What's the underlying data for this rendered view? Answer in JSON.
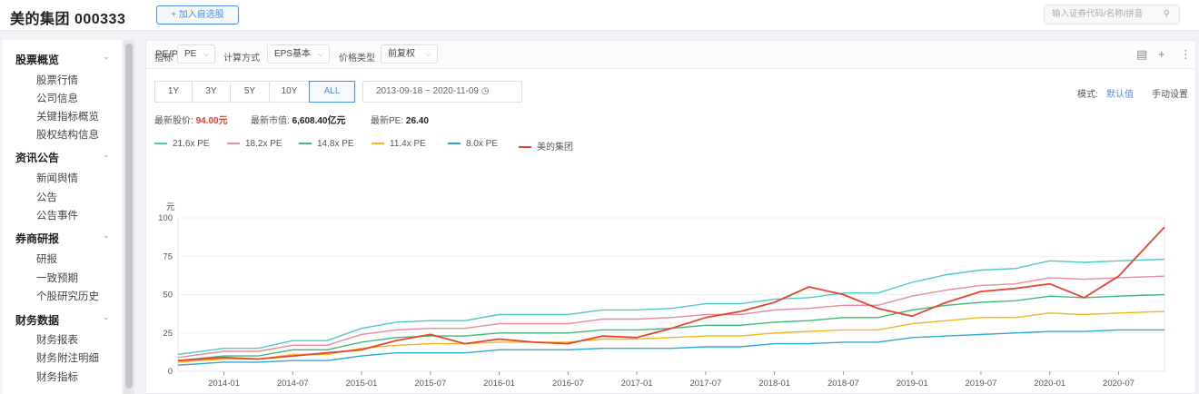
{
  "header": {
    "company": "美的集团  000333",
    "add_button": "+ 加入自选股",
    "search_placeholder": "输入证券代码/名称/拼音",
    "search_icon": "search-icon"
  },
  "sidebar": {
    "sections": [
      {
        "title": "股票概览",
        "items": [
          "股票行情",
          "公司信息",
          "关键指标概览",
          "股权结构信息"
        ]
      },
      {
        "title": "资讯公告",
        "items": [
          "新闻舆情",
          "公告",
          "公告事件"
        ]
      },
      {
        "title": "券商研报",
        "items": [
          "研报",
          "一致预期",
          "个股研究历史"
        ]
      },
      {
        "title": "财务数据",
        "items": [
          "财务报表",
          "财务附注明细",
          "财务指标"
        ]
      }
    ]
  },
  "panel": {
    "title": "PE/PB Bands",
    "controls": {
      "indicator_label": "指标",
      "indicator_value": "PE",
      "calc_label": "计算方式",
      "calc_value": "EPS基本",
      "adjust_label": "价格类型",
      "adjust_value": "前复权"
    },
    "periods": [
      "1Y",
      "3Y",
      "5Y",
      "10Y",
      "ALL"
    ],
    "active_period": "ALL",
    "date_range": "2013-09-18  ~  2020-11-09",
    "mode_label": "模式:",
    "mode_default": "默认值",
    "mode_custom": "手动设置",
    "stats": {
      "price_label": "最新股价:",
      "price_value": "94.00元",
      "mktcap_label": "最新市值:",
      "mktcap_value": "6,608.40亿元",
      "pe_label": "最新PE:",
      "pe_value": "26.40"
    }
  },
  "colors": {
    "band1": "#4fc8c8",
    "band2": "#e88aa0",
    "band3": "#3fb97a",
    "band4": "#f0b722",
    "band5": "#2ea7d8",
    "price": "#e5452f",
    "accent": "#4a90e2"
  },
  "chart_data": {
    "type": "line",
    "y_unit": "元",
    "ylim": [
      0,
      100
    ],
    "y_ticks": [
      "0",
      "25",
      "50",
      "75",
      "100"
    ],
    "x_ticks": [
      "2014-01",
      "2014-07",
      "2015-01",
      "2015-07",
      "2016-01",
      "2016-07",
      "2017-01",
      "2017-07",
      "2018-01",
      "2018-07",
      "2019-01",
      "2019-07",
      "2020-01",
      "2020-07"
    ],
    "x": [
      "2013-09",
      "2014-01",
      "2014-04",
      "2014-07",
      "2014-10",
      "2015-01",
      "2015-04",
      "2015-07",
      "2015-10",
      "2016-01",
      "2016-04",
      "2016-07",
      "2016-10",
      "2017-01",
      "2017-04",
      "2017-07",
      "2017-10",
      "2018-01",
      "2018-04",
      "2018-07",
      "2018-10",
      "2019-01",
      "2019-04",
      "2019-07",
      "2019-10",
      "2020-01",
      "2020-04",
      "2020-07",
      "2020-11"
    ],
    "series": [
      {
        "name": "21.6x PE",
        "values": [
          11,
          15,
          15,
          20,
          20,
          28,
          32,
          33,
          33,
          37,
          37,
          37,
          40,
          40,
          41,
          44,
          44,
          47,
          48,
          51,
          51,
          58,
          63,
          66,
          67,
          72,
          71,
          72,
          73
        ]
      },
      {
        "name": "18.2x PE",
        "values": [
          9,
          13,
          13,
          17,
          17,
          24,
          27,
          28,
          28,
          31,
          31,
          31,
          34,
          34,
          35,
          37,
          37,
          40,
          41,
          43,
          43,
          49,
          53,
          56,
          57,
          61,
          60,
          61,
          62
        ]
      },
      {
        "name": "14.8x PE",
        "values": [
          7,
          10,
          10,
          14,
          14,
          19,
          22,
          23,
          23,
          25,
          25,
          25,
          27,
          27,
          28,
          30,
          30,
          32,
          33,
          35,
          35,
          40,
          43,
          45,
          46,
          49,
          48,
          49,
          50
        ]
      },
      {
        "name": "11.4x PE",
        "values": [
          6,
          8,
          8,
          11,
          11,
          15,
          17,
          18,
          18,
          19,
          19,
          19,
          21,
          21,
          22,
          23,
          23,
          25,
          26,
          27,
          27,
          31,
          33,
          35,
          35,
          38,
          37,
          38,
          39
        ]
      },
      {
        "name": "8.0x PE",
        "values": [
          4,
          6,
          6,
          7,
          7,
          10,
          12,
          12,
          12,
          14,
          14,
          14,
          15,
          15,
          15,
          16,
          16,
          18,
          18,
          19,
          19,
          22,
          23,
          24,
          25,
          26,
          26,
          27,
          27
        ]
      },
      {
        "name": "美的集团",
        "values": [
          7,
          9,
          8,
          10,
          12,
          14,
          20,
          24,
          18,
          21,
          19,
          18,
          23,
          22,
          28,
          35,
          39,
          45,
          55,
          50,
          41,
          36,
          45,
          52,
          54,
          57,
          48,
          62,
          94
        ]
      }
    ]
  }
}
